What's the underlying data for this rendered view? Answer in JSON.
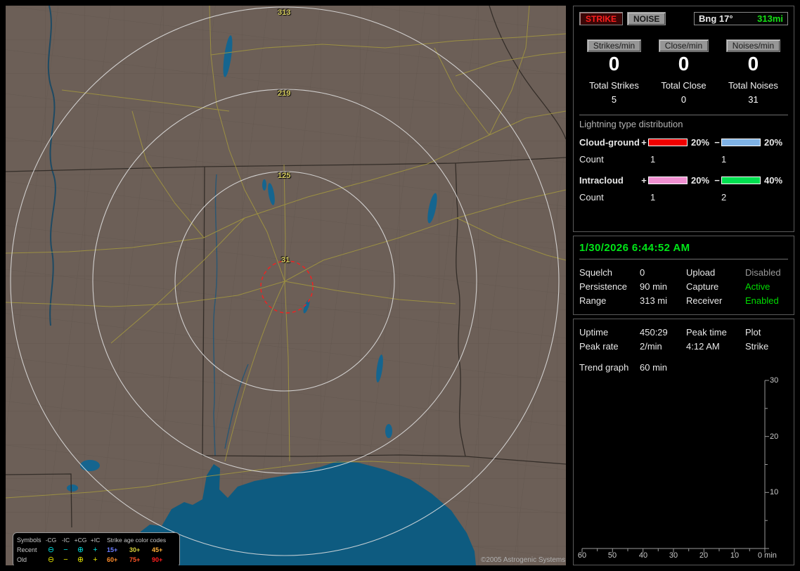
{
  "map": {
    "ring_labels": [
      "313",
      "219",
      "125",
      "31"
    ],
    "copyright": "©2005 Astrogenic Systems",
    "legend": {
      "symbols_header": "Symbols",
      "type_cols": [
        "-CG",
        "-IC",
        "+CG",
        "+IC"
      ],
      "age_header": "Strike age color codes",
      "recent": {
        "label": "Recent",
        "color": "#00dcdc",
        "symbols": [
          "⊖",
          "−",
          "⊕",
          "+"
        ],
        "ages": [
          {
            "t": "15+",
            "c": "#6b7dff"
          },
          {
            "t": "30+",
            "c": "#d8d23c"
          },
          {
            "t": "45+",
            "c": "#ffb03a"
          }
        ]
      },
      "old": {
        "label": "Old",
        "color": "#e0e000",
        "symbols": [
          "⊖",
          "−",
          "⊕",
          "+"
        ],
        "ages": [
          {
            "t": "60+",
            "c": "#ff8c2a"
          },
          {
            "t": "75+",
            "c": "#ff5526"
          },
          {
            "t": "90+",
            "c": "#ff1e1e"
          }
        ]
      }
    }
  },
  "sidebar": {
    "mode": {
      "strike": "STRIKE",
      "noise": "NOISE"
    },
    "bearing": {
      "label": "Bng 17°",
      "range": "313mi"
    },
    "rates": [
      {
        "header": "Strikes/min",
        "value": "0",
        "total_label": "Total Strikes",
        "total": "5"
      },
      {
        "header": "Close/min",
        "value": "0",
        "total_label": "Total Close",
        "total": "0"
      },
      {
        "header": "Noises/min",
        "value": "0",
        "total_label": "Total Noises",
        "total": "31"
      }
    ],
    "distribution": {
      "title": "Lightning type distribution",
      "count_label": "Count",
      "rows": [
        {
          "name": "Cloud-ground",
          "plus": "+",
          "minus": "−",
          "pos_pct": "20%",
          "neg_pct": "20%",
          "pos_count": "1",
          "neg_count": "1",
          "pos_color": "#f00000",
          "neg_color": "#7fb2e5"
        },
        {
          "name": "Intracloud",
          "plus": "+",
          "minus": "−",
          "pos_pct": "20%",
          "neg_pct": "40%",
          "pos_count": "1",
          "neg_count": "2",
          "pos_color": "#ef8fd0",
          "neg_color": "#00e050"
        }
      ]
    },
    "status": {
      "datetime": "1/30/2026 6:44:52 AM",
      "rows": [
        {
          "l1": "Squelch",
          "v1": "0",
          "l2": "Upload",
          "v2": "Disabled",
          "c2": "#9a9a9a"
        },
        {
          "l1": "Persistence",
          "v1": "90 min",
          "l2": "Capture",
          "v2": "Active",
          "c2": "#00dc00"
        },
        {
          "l1": "Range",
          "v1": "313 mi",
          "l2": "Receiver",
          "v2": "Enabled",
          "c2": "#00dc00"
        }
      ]
    },
    "trend": {
      "uptime_label": "Uptime",
      "uptime_value": "450:29",
      "peak_time_label": "Peak time",
      "peak_time_value": "4:12 AM",
      "plot_label": "Plot",
      "plot_value": "Strike",
      "peak_rate_label": "Peak rate",
      "peak_rate_value": "2/min",
      "graph_label": "Trend graph",
      "graph_window": "60 min",
      "y_ticks": [
        "30",
        "20",
        "10"
      ],
      "x_ticks": [
        "60",
        "50",
        "40",
        "30",
        "20",
        "10"
      ],
      "x_origin": "0 min"
    }
  }
}
